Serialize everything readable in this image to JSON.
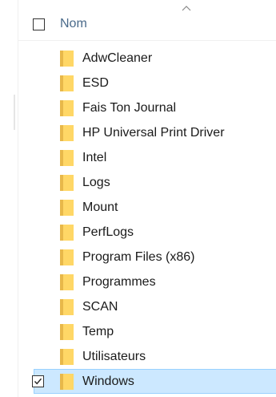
{
  "header": {
    "column_label": "Nom",
    "sort_indicator_icon": "chevron-up-icon"
  },
  "folders": [
    {
      "label": "AdwCleaner",
      "checked": false,
      "selected": false
    },
    {
      "label": "ESD",
      "checked": false,
      "selected": false
    },
    {
      "label": "Fais Ton Journal",
      "checked": false,
      "selected": false
    },
    {
      "label": "HP Universal Print Driver",
      "checked": false,
      "selected": false
    },
    {
      "label": "Intel",
      "checked": false,
      "selected": false
    },
    {
      "label": "Logs",
      "checked": false,
      "selected": false
    },
    {
      "label": "Mount",
      "checked": false,
      "selected": false
    },
    {
      "label": "PerfLogs",
      "checked": false,
      "selected": false
    },
    {
      "label": "Program Files (x86)",
      "checked": false,
      "selected": false
    },
    {
      "label": "Programmes",
      "checked": false,
      "selected": false
    },
    {
      "label": "SCAN",
      "checked": false,
      "selected": false
    },
    {
      "label": "Temp",
      "checked": false,
      "selected": false
    },
    {
      "label": "Utilisateurs",
      "checked": false,
      "selected": false
    },
    {
      "label": "Windows",
      "checked": true,
      "selected": true
    }
  ],
  "colors": {
    "folder_fill": "#ffd766",
    "folder_tab": "#e8b84a",
    "selection_bg": "#cce8ff",
    "selection_border": "#99d1ff",
    "header_text": "#4a6a8a"
  }
}
